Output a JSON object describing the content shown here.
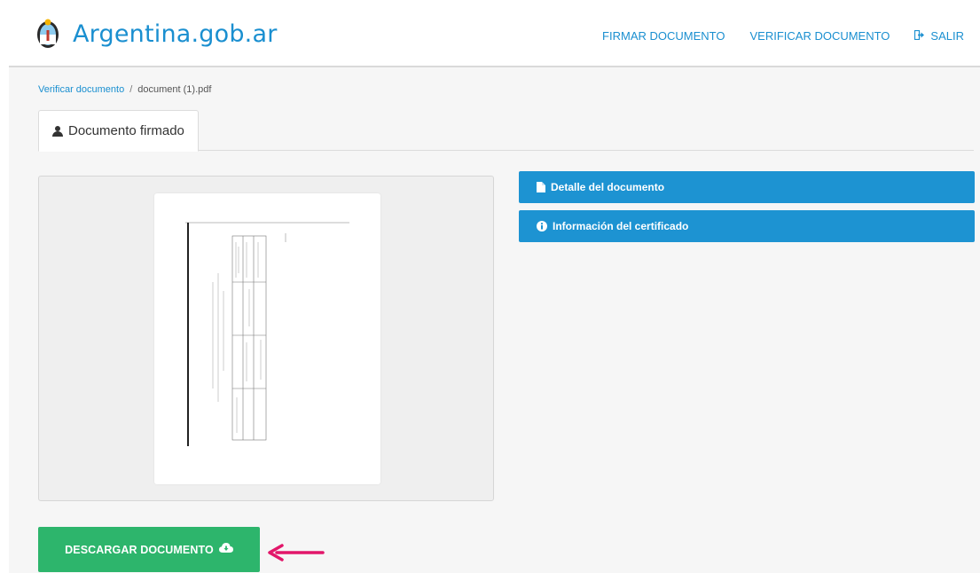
{
  "header": {
    "brand": "Argentina.gob.ar",
    "nav": {
      "firmar": "FIRMAR DOCUMENTO",
      "verificar": "VERIFICAR DOCUMENTO",
      "salir": "SALIR"
    },
    "brand_color": "#1a8fd0"
  },
  "breadcrumb": {
    "parent": "Verificar documento",
    "separator": "/",
    "current": "document (1).pdf"
  },
  "tabs": [
    {
      "label": "Documento firmado",
      "icon": "user-icon",
      "active": true
    }
  ],
  "panels": {
    "detalle": {
      "label": "Detalle del documento",
      "icon": "file-icon"
    },
    "info": {
      "label": "Información del certificado",
      "icon": "info-circle-icon"
    },
    "color": "#1d93d2"
  },
  "actions": {
    "download_label": "DESCARGAR DOCUMENTO",
    "download_icon": "cloud-download-icon",
    "download_color": "#2db56c",
    "annotation_arrow_color": "#e2176a"
  }
}
